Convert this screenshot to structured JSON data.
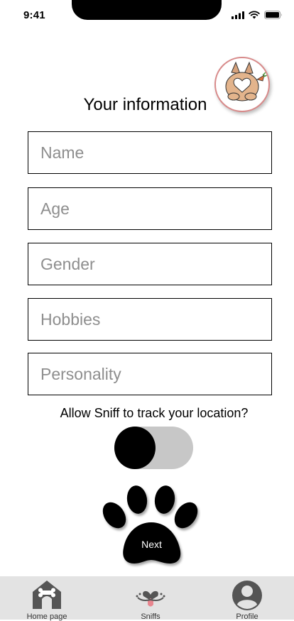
{
  "status_bar": {
    "time": "9:41"
  },
  "header": {
    "title": "Your information"
  },
  "form": {
    "fields": [
      {
        "placeholder": "Name",
        "value": ""
      },
      {
        "placeholder": "Age",
        "value": ""
      },
      {
        "placeholder": "Gender",
        "value": ""
      },
      {
        "placeholder": "Hobbies",
        "value": ""
      },
      {
        "placeholder": "Personality",
        "value": ""
      }
    ]
  },
  "location": {
    "label": "Allow Sniff to track your location?",
    "toggle_on": false
  },
  "next_button": {
    "label": "Next"
  },
  "bottom_nav": {
    "items": [
      {
        "label": "Home page",
        "icon": "house-icon"
      },
      {
        "label": "Sniffs",
        "icon": "dog-face-icon"
      },
      {
        "label": "Profile",
        "icon": "user-icon"
      }
    ]
  },
  "colors": {
    "avatar_border": "#d88a8a",
    "toggle_track": "#c7c7c7",
    "nav_background": "#e3e3e3",
    "tongue": "#e8868f"
  }
}
